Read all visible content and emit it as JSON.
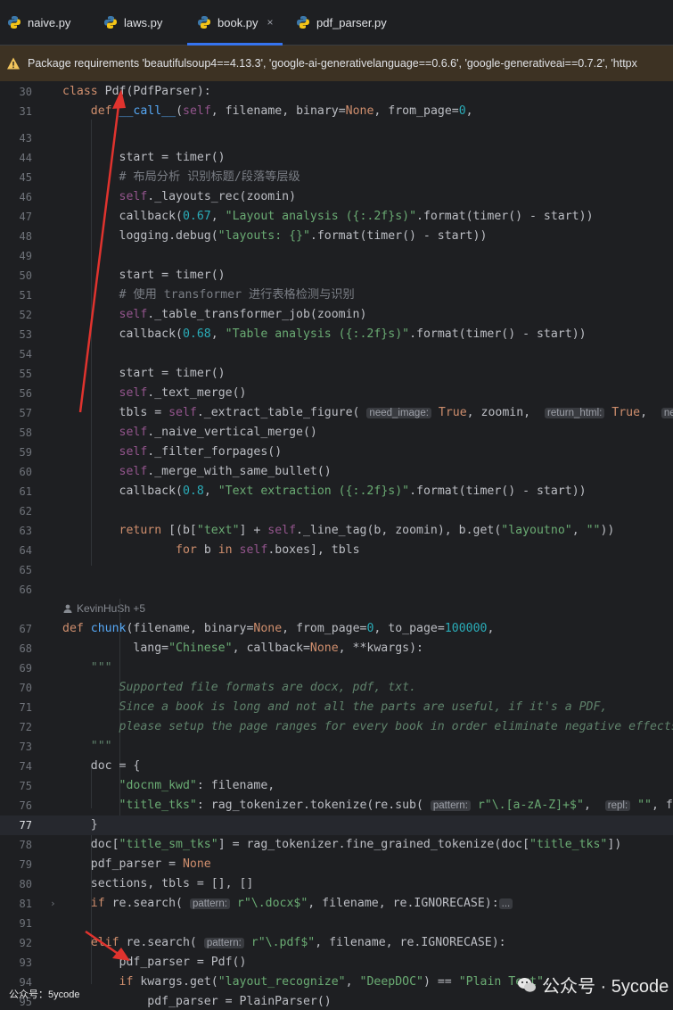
{
  "tabs": [
    {
      "label": "naive.py"
    },
    {
      "label": "laws.py"
    },
    {
      "label": "book.py",
      "close": "×"
    },
    {
      "label": "pdf_parser.py"
    }
  ],
  "banner": {
    "text": "Package requirements 'beautifulsoup4==4.13.3', 'google-ai-generativelanguage==0.6.6', 'google-generativeai==0.7.2', 'httpx"
  },
  "author_hint": "KevinHuSh +5",
  "watermark": {
    "brand": "公众号 · 5ycode",
    "corner": "公众号：5ycode"
  },
  "colors": {
    "accent": "#3574f0",
    "annotation": "#e0332e",
    "banner_bg": "#3d3223"
  }
}
